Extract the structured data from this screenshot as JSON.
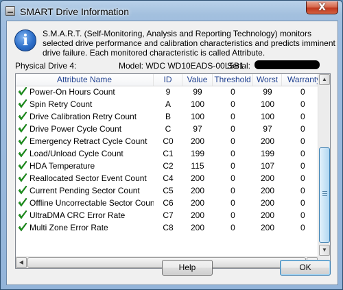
{
  "window": {
    "title": "SMART Drive Information",
    "close_glyph": "X"
  },
  "info": {
    "icon_glyph": "i",
    "description": "S.M.A.R.T. (Self-Monitoring, Analysis and Reporting Technology) monitors selected drive performance and calibration characteristics and predicts imminent drive failure. Each monitored characteristic is called Attribute."
  },
  "drive": {
    "physical": "Physical Drive 4:",
    "model": "Model: WDC WD10EADS-00L5B1",
    "serial_label": "Serial:"
  },
  "table": {
    "columns": [
      "Attribute Name",
      "ID",
      "Value",
      "Threshold",
      "Worst",
      "Warranty"
    ],
    "rows": [
      {
        "name": "Power-On Hours Count",
        "id": "9",
        "value": "99",
        "threshold": "0",
        "worst": "99",
        "warranty": "0"
      },
      {
        "name": "Spin Retry Count",
        "id": "A",
        "value": "100",
        "threshold": "0",
        "worst": "100",
        "warranty": "0"
      },
      {
        "name": "Drive Calibration Retry Count",
        "id": "B",
        "value": "100",
        "threshold": "0",
        "worst": "100",
        "warranty": "0"
      },
      {
        "name": "Drive Power Cycle Count",
        "id": "C",
        "value": "97",
        "threshold": "0",
        "worst": "97",
        "warranty": "0"
      },
      {
        "name": "Emergency Retract Cycle Count",
        "id": "C0",
        "value": "200",
        "threshold": "0",
        "worst": "200",
        "warranty": "0"
      },
      {
        "name": "Load/Unload Cycle Count",
        "id": "C1",
        "value": "199",
        "threshold": "0",
        "worst": "199",
        "warranty": "0"
      },
      {
        "name": "HDA Temperature",
        "id": "C2",
        "value": "115",
        "threshold": "0",
        "worst": "107",
        "warranty": "0"
      },
      {
        "name": "Reallocated Sector Event Count",
        "id": "C4",
        "value": "200",
        "threshold": "0",
        "worst": "200",
        "warranty": "0"
      },
      {
        "name": "Current Pending Sector Count",
        "id": "C5",
        "value": "200",
        "threshold": "0",
        "worst": "200",
        "warranty": "0"
      },
      {
        "name": "Offline Uncorrectable Sector Count",
        "id": "C6",
        "value": "200",
        "threshold": "0",
        "worst": "200",
        "warranty": "0"
      },
      {
        "name": "UltraDMA CRC Error Rate",
        "id": "C7",
        "value": "200",
        "threshold": "0",
        "worst": "200",
        "warranty": "0"
      },
      {
        "name": "Multi Zone Error Rate",
        "id": "C8",
        "value": "200",
        "threshold": "0",
        "worst": "200",
        "warranty": "0"
      }
    ],
    "row_icon": "check-icon",
    "check_color": "#1c9a1c"
  },
  "buttons": {
    "help": "Help",
    "ok": "OK"
  },
  "colors": {
    "header_text": "#1e3f8f",
    "accent": "#3c7fb1"
  }
}
